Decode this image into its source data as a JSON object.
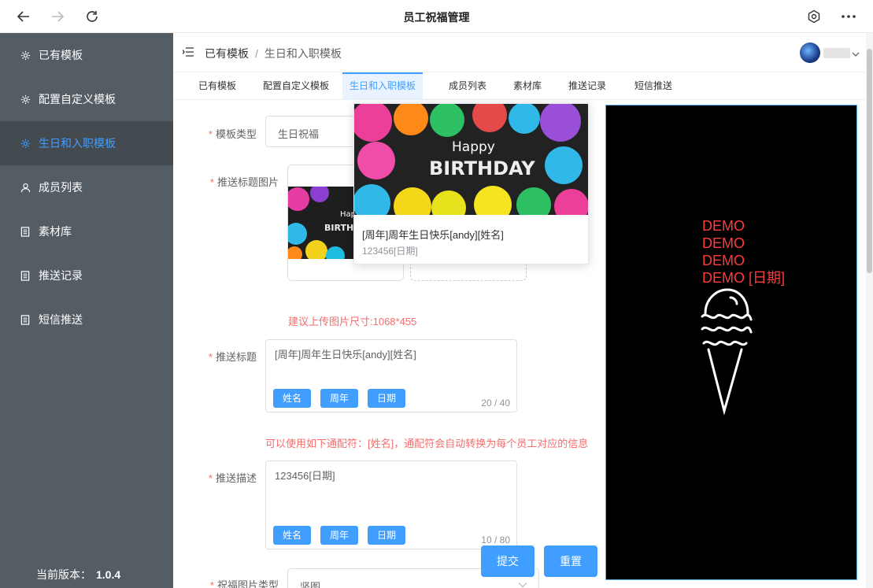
{
  "window": {
    "title": "员工祝福管理",
    "back_icon": "arrow-left-icon",
    "forward_icon": "arrow-right-icon",
    "reload_icon": "reload-icon",
    "settings_icon": "hexagon-settings-icon",
    "more_icon": "more-icon"
  },
  "sidebar": {
    "items": [
      {
        "label": "已有模板",
        "icon": "gear-icon"
      },
      {
        "label": "配置自定义模板",
        "icon": "gear-icon"
      },
      {
        "label": "生日和入职模板",
        "icon": "gear-icon",
        "active": true
      },
      {
        "label": "成员列表",
        "icon": "user-icon"
      },
      {
        "label": "素材库",
        "icon": "document-icon"
      },
      {
        "label": "推送记录",
        "icon": "document-icon"
      },
      {
        "label": "短信推送",
        "icon": "document-icon"
      }
    ],
    "version_label": "当前版本：",
    "version_value": "1.0.4",
    "bg_color": "#545c64",
    "active_color": "#409eff"
  },
  "header": {
    "breadcrumb_root": "已有模板",
    "breadcrumb_sep": "/",
    "breadcrumb_current": "生日和入职模板"
  },
  "tabs": [
    "已有模板",
    "配置自定义模板",
    "生日和入职模板",
    "成员列表",
    "素材库",
    "推送记录",
    "短信推送"
  ],
  "form": {
    "template_type_label": "模板类型",
    "template_type_value": "生日祝福",
    "title_image_label": "推送标题图片",
    "size_tip": "建议上传图片尺寸:1068*455",
    "push_title_label": "推送标题",
    "push_title_value": "[周年]周年生日快乐[andy][姓名]",
    "push_title_count": "20 / 40",
    "tags": [
      "姓名",
      "周年",
      "日期"
    ],
    "wildcard_tip": "可以使用如下通配符：[姓名]，通配符会自动转换为每个员工对应的信息",
    "push_desc_label": "推送描述",
    "push_desc_value": "123456[日期]",
    "push_desc_count": "10 / 80",
    "bless_image_type_label": "祝福图片类型",
    "bless_image_type_value": "竖图",
    "submit_label": "提交",
    "reset_label": "重置"
  },
  "popover": {
    "image_text_1": "Happy",
    "image_text_2": "BIRTHDAY",
    "title": "[周年]周年生日快乐[andy][姓名]",
    "desc": "123456[日期]"
  },
  "preview": {
    "lines": [
      "DEMO",
      "DEMO",
      "DEMO",
      "DEMO [日期]"
    ]
  }
}
